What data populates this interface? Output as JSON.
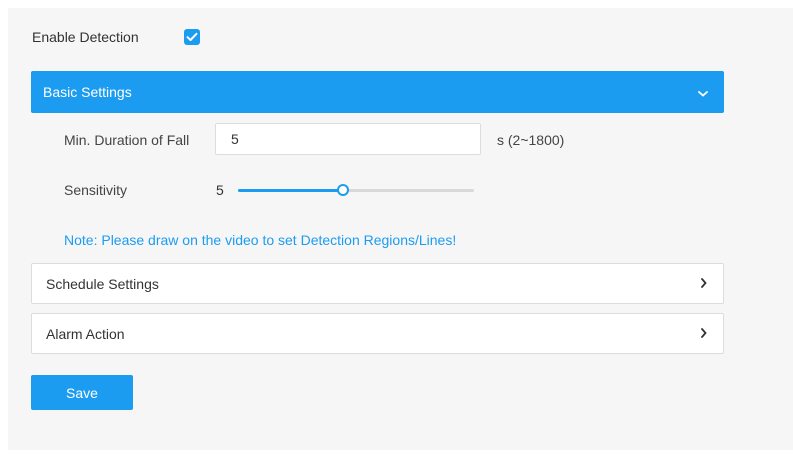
{
  "enable_detection": {
    "label": "Enable Detection",
    "checked": true
  },
  "basic_settings": {
    "title": "Basic Settings",
    "expanded": true
  },
  "min_duration": {
    "label": "Min. Duration of Fall",
    "value": "5",
    "hint": "s (2~1800)"
  },
  "sensitivity": {
    "label": "Sensitivity",
    "value": "5",
    "min": 1,
    "max": 10
  },
  "note": "Note: Please draw on the video to set Detection Regions/Lines!",
  "schedule_settings": {
    "title": "Schedule Settings"
  },
  "alarm_action": {
    "title": "Alarm Action"
  },
  "save_label": "Save",
  "colors": {
    "accent": "#1c9cf0",
    "panel_bg": "#f6f6f6",
    "border": "#dcdcdc"
  }
}
